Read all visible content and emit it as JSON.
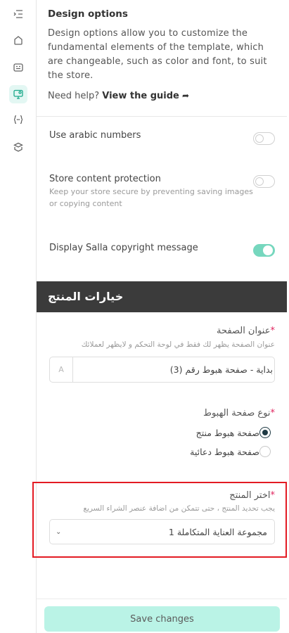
{
  "sidebar": {
    "icons": [
      "collapse-menu-icon",
      "home-icon",
      "card-icon",
      "design-monitor-icon",
      "code-braces-icon",
      "layers-icon"
    ],
    "active_index": 3,
    "accent_color": "#e3f7f3"
  },
  "intro": {
    "title": "Design options",
    "description": "Design options allow you to customize the fundamental elements of the template, which are changeable, such as color and font, to suit the store.",
    "help_prefix": "Need help?",
    "help_link": "View the guide"
  },
  "options": [
    {
      "label": "Use arabic numbers",
      "description": "",
      "enabled": false
    },
    {
      "label": "Store content protection",
      "description": "Keep your store secure by preventing saving images or copying content",
      "enabled": false
    },
    {
      "label": "Display Salla copyright message",
      "description": "",
      "enabled": true
    }
  ],
  "product_section": {
    "title": "خيارات المنتج",
    "page_title_field": {
      "label": "عنوان الصفحة",
      "required_mark": "*",
      "hint": "عنوان الصفحة يظهر لك فقط في لوحة التحكم و لايظهر لعملائك",
      "value": "بداية - صفحة هبوط رقم (3)"
    },
    "landing_type_field": {
      "label": "نوع صفحة الهبوط",
      "required_mark": "*",
      "options": [
        "صفحة هبوط منتج",
        "صفحة هبوط دعائية"
      ],
      "selected_index": 0
    },
    "product_field": {
      "label": "اختر المنتج",
      "required_mark": "*",
      "hint": "يجب تحديد المنتج ، حتى تتمكن من اضافة عنصر الشراء السريع",
      "value": "مجموعة العناية المتكاملة 1"
    }
  },
  "footer": {
    "save_label": "Save changes",
    "save_color": "#baf3e6"
  },
  "colors": {
    "toggle_on": "#76d7be",
    "section_bar": "#3b3b3b",
    "highlight_border": "#e31b23",
    "required": "#e0245e"
  }
}
